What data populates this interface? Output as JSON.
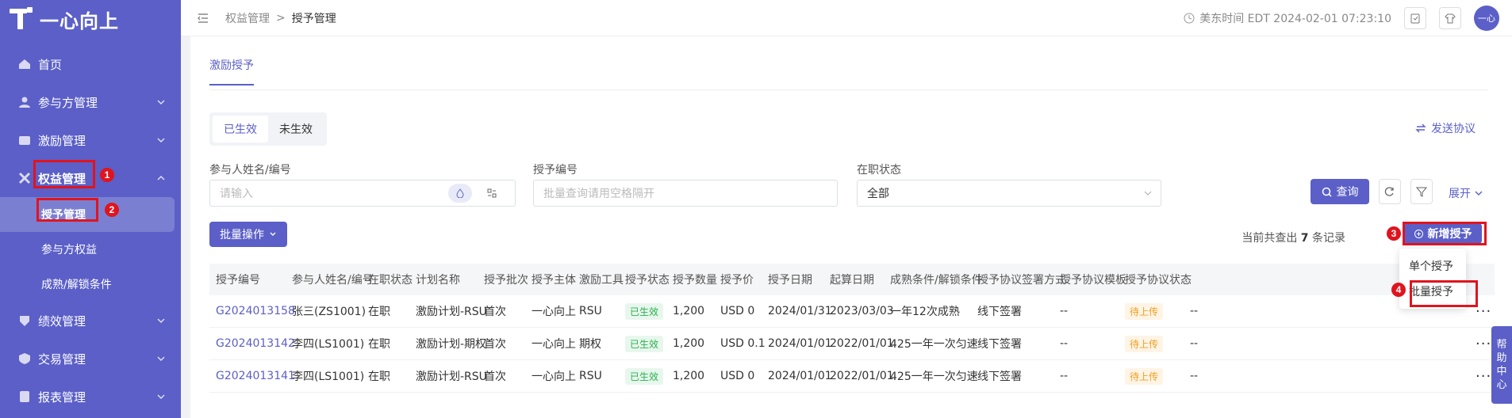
{
  "app": {
    "logo_text": "一心向上"
  },
  "sidebar": {
    "items": [
      {
        "label": "首页",
        "icon": "home-icon"
      },
      {
        "label": "参与方管理",
        "icon": "person-icon"
      },
      {
        "label": "激励管理",
        "icon": "incentive-icon"
      },
      {
        "label": "权益管理",
        "icon": "equity-icon"
      },
      {
        "label": "授予管理",
        "icon": ""
      },
      {
        "label": "参与方权益",
        "icon": ""
      },
      {
        "label": "成熟/解锁条件",
        "icon": ""
      },
      {
        "label": "绩效管理",
        "icon": "performance-icon"
      },
      {
        "label": "交易管理",
        "icon": "trade-icon"
      },
      {
        "label": "报表管理",
        "icon": "report-icon"
      }
    ]
  },
  "annotations": {
    "n1": "1",
    "n2": "2",
    "n3": "3",
    "n4": "4"
  },
  "breadcrumb": {
    "parent": "权益管理",
    "sep": ">",
    "current": "授予管理"
  },
  "topbar": {
    "time": "美东时间 EDT 2024-02-01 07:23:10",
    "avatar": "一心"
  },
  "main": {
    "tab": "激励授予",
    "seg": [
      "已生效",
      "未生效"
    ],
    "send_protocol": "发送协议",
    "filters": {
      "name_label": "参与人姓名/编号",
      "name_placeholder": "请输入",
      "grant_label": "授予编号",
      "grant_placeholder": "批量查询请用空格隔开",
      "status_label": "在职状态",
      "status_value": "全部"
    },
    "query_label": "查询",
    "expand_label": "展开",
    "batch_label": "批量操作",
    "total_prefix": "当前共查出",
    "total_count": "7",
    "total_suffix": "条记录",
    "add_grant_label": "新增授予"
  },
  "table": {
    "headers": [
      "授予编号",
      "参与人姓名/编号",
      "在职状态",
      "计划名称",
      "授予批次",
      "授予主体",
      "激励工具",
      "授予状态",
      "授予数量",
      "授予价",
      "授予日期",
      "起算日期",
      "成熟条件/解锁条件",
      "授予协议签署方式",
      "授予协议模板",
      "授予协议状态"
    ],
    "rows": [
      [
        "G2024013158",
        "张三(ZS1001)",
        "在职",
        "激励计划-RSU",
        "首次",
        "一心向上",
        "RSU",
        "已生效",
        "1,200",
        "USD  0",
        "2024/01/31",
        "2023/03/03",
        "一年12次成熟",
        "线下签署",
        "--",
        "待上传",
        "--"
      ],
      [
        "G2024013142",
        "李四(LS1001)",
        "在职",
        "激励计划-期权",
        "首次",
        "一心向上",
        "期权",
        "已生效",
        "1,200",
        "USD  0.1",
        "2024/01/01",
        "2022/01/01",
        "425一年一次匀速",
        "线下签署",
        "--",
        "待上传",
        "--"
      ],
      [
        "G2024013141",
        "李四(LS1001)",
        "在职",
        "激励计划-RSU",
        "首次",
        "一心向上",
        "RSU",
        "已生效",
        "1,200",
        "USD  0",
        "2024/01/01",
        "2022/01/01",
        "425一年一次匀速",
        "线下签署",
        "--",
        "待上传",
        "--"
      ]
    ],
    "more": "···"
  },
  "dropdown": {
    "items": [
      "单个授予",
      "批量授予"
    ]
  },
  "help": [
    "帮",
    "助",
    "中",
    "心"
  ],
  "colors": {
    "brand": "#5b5fc7",
    "annotation": "#e0141e"
  }
}
